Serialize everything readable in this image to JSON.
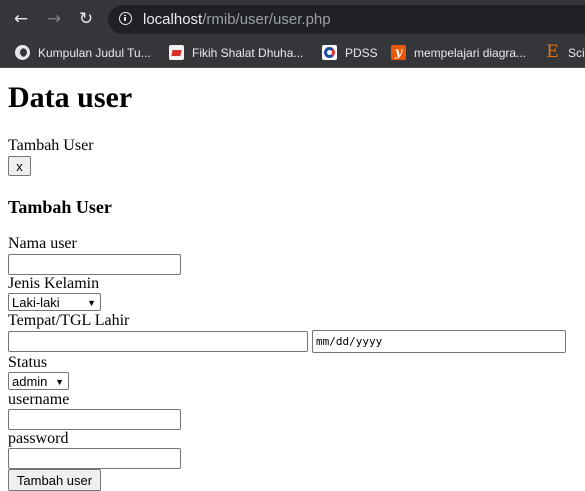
{
  "browser": {
    "url_host": "localhost",
    "url_path": "/rmib/user/user.php",
    "bookmarks": [
      {
        "label": "Kumpulan Judul Tu...",
        "icon": "globe-icon"
      },
      {
        "label": "Fikih Shalat Dhuha...",
        "icon": "document-icon"
      },
      {
        "label": "PDSS",
        "icon": "pdss-logo-icon"
      },
      {
        "label": "mempelajari diagra...",
        "icon": "y-letter-icon"
      },
      {
        "label": "Scie",
        "icon": "e-letter-icon"
      }
    ]
  },
  "page": {
    "title": "Data user",
    "toggle_label": "Tambah User",
    "close_button": "x",
    "form": {
      "heading": "Tambah User",
      "nama_label": "Nama user",
      "nama_value": "",
      "gender_label": "Jenis Kelamin",
      "gender_value": "Laki-laki",
      "ttl_label": "Tempat/TGL Lahir",
      "tempat_value": "",
      "date_placeholder": "mm/dd/yyyy",
      "status_label": "Status",
      "status_value": "admin",
      "username_label": "username",
      "username_value": "",
      "password_label": "password",
      "password_value": "",
      "submit_label": "Tambah user"
    }
  }
}
